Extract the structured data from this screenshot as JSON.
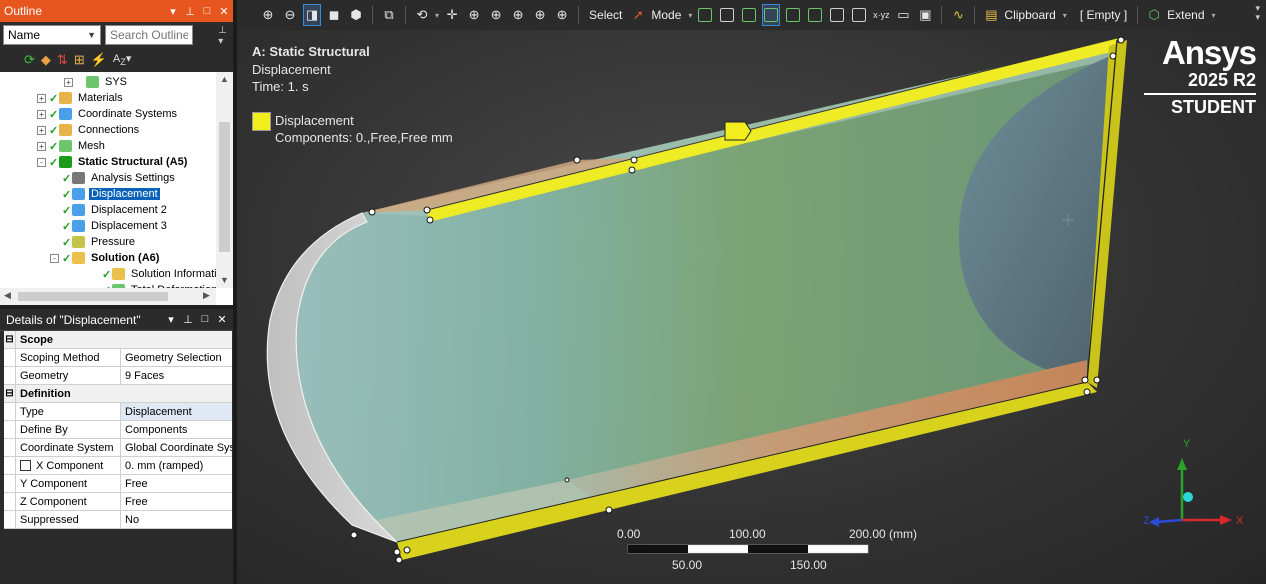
{
  "outline": {
    "title": "Outline",
    "filter_select": "Name",
    "search_placeholder": "Search Outline",
    "tree": [
      {
        "label": "SYS",
        "level": 3,
        "expander": "+",
        "check": false,
        "icon": "geometry-icon",
        "bold": false,
        "selected": false
      },
      {
        "label": "Materials",
        "level": 1,
        "expander": "+",
        "check": true,
        "icon": "materials-icon",
        "bold": false,
        "selected": false
      },
      {
        "label": "Coordinate Systems",
        "level": 1,
        "expander": "+",
        "check": true,
        "icon": "coordinate-systems-icon",
        "bold": false,
        "selected": false
      },
      {
        "label": "Connections",
        "level": 1,
        "expander": "+",
        "check": true,
        "icon": "connections-icon",
        "bold": false,
        "selected": false
      },
      {
        "label": "Mesh",
        "level": 1,
        "expander": "+",
        "check": true,
        "icon": "mesh-icon",
        "bold": false,
        "selected": false
      },
      {
        "label": "Static Structural (A5)",
        "level": 1,
        "expander": "-",
        "check": true,
        "icon": "static-structural-icon",
        "bold": true,
        "selected": false
      },
      {
        "label": "Analysis Settings",
        "level": 2,
        "expander": "",
        "check": true,
        "icon": "analysis-settings-icon",
        "bold": false,
        "selected": false
      },
      {
        "label": "Displacement",
        "level": 2,
        "expander": "",
        "check": true,
        "icon": "displacement-icon",
        "bold": false,
        "selected": true
      },
      {
        "label": "Displacement 2",
        "level": 2,
        "expander": "",
        "check": true,
        "icon": "displacement-icon",
        "bold": false,
        "selected": false
      },
      {
        "label": "Displacement 3",
        "level": 2,
        "expander": "",
        "check": true,
        "icon": "displacement-icon",
        "bold": false,
        "selected": false
      },
      {
        "label": "Pressure",
        "level": 2,
        "expander": "",
        "check": true,
        "icon": "pressure-icon",
        "bold": false,
        "selected": false
      },
      {
        "label": "Solution (A6)",
        "level": 2,
        "expander": "-",
        "check": true,
        "icon": "solution-icon",
        "bold": true,
        "selected": false
      },
      {
        "label": "Solution Information",
        "level": 3,
        "expander": "",
        "check": true,
        "icon": "solution-information-icon",
        "bold": false,
        "selected": false
      },
      {
        "label": "Total Deformation",
        "level": 3,
        "expander": "",
        "check": true,
        "icon": "total-deformation-icon",
        "bold": false,
        "selected": false
      }
    ]
  },
  "details": {
    "title": "Details of \"Displacement\"",
    "rows": [
      {
        "type": "section",
        "label": "Scope"
      },
      {
        "type": "prop",
        "key": "Scoping Method",
        "value": "Geometry Selection",
        "highlight": false,
        "checkbox": false
      },
      {
        "type": "prop",
        "key": "Geometry",
        "value": "9 Faces",
        "highlight": false,
        "checkbox": false
      },
      {
        "type": "section",
        "label": "Definition"
      },
      {
        "type": "prop",
        "key": "Type",
        "value": "Displacement",
        "highlight": true,
        "checkbox": false
      },
      {
        "type": "prop",
        "key": "Define By",
        "value": "Components",
        "highlight": false,
        "checkbox": false
      },
      {
        "type": "prop",
        "key": "Coordinate System",
        "value": "Global Coordinate System",
        "highlight": false,
        "checkbox": false
      },
      {
        "type": "prop",
        "key": "X Component",
        "value": "0. mm  (ramped)",
        "highlight": false,
        "checkbox": true
      },
      {
        "type": "prop",
        "key": "Y Component",
        "value": "Free",
        "highlight": false,
        "checkbox": false
      },
      {
        "type": "prop",
        "key": "Z Component",
        "value": "Free",
        "highlight": false,
        "checkbox": false
      },
      {
        "type": "prop",
        "key": "Suppressed",
        "value": "No",
        "highlight": false,
        "checkbox": false
      }
    ]
  },
  "toolbar": {
    "select_label": "Select",
    "mode_label": "Mode",
    "clipboard_label": "Clipboard",
    "empty_label": "[ Empty ]",
    "extend_label": "Extend",
    "xyz_label": "x·yz"
  },
  "viewport": {
    "analysis_title": "A: Static Structural",
    "object_name": "Displacement",
    "time_text": "Time: 1. s",
    "legend_name": "Displacement",
    "legend_components": "Components: 0.,Free,Free mm",
    "brand_name": "Ansys",
    "brand_version": "2025 R2",
    "brand_edition": "STUDENT",
    "highlight_color": "#f2ee1d",
    "scale": {
      "top_labels": [
        "0.00",
        "100.00",
        "200.00 (mm)"
      ],
      "bottom_labels": [
        "50.00",
        "150.00"
      ]
    },
    "triad": {
      "x_label": "X",
      "y_label": "Y",
      "z_label": "Z"
    }
  }
}
